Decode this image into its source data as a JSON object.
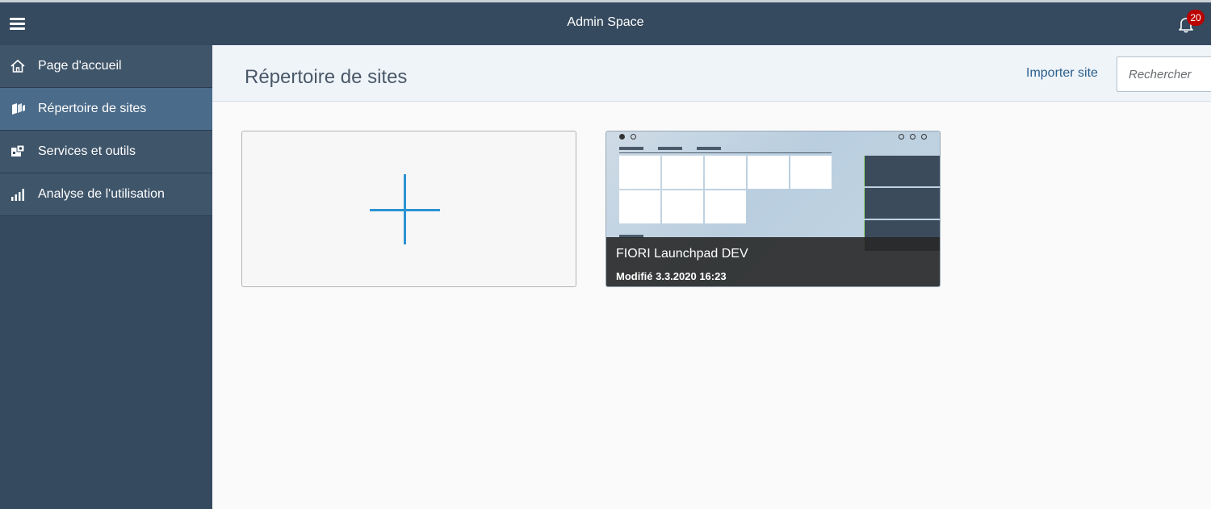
{
  "shell": {
    "title": "Admin Space",
    "notifications_count": "20"
  },
  "sidebar": {
    "items": [
      {
        "label": "Page d'accueil",
        "icon": "home-icon",
        "active": false
      },
      {
        "label": "Répertoire de sites",
        "icon": "sites-icon",
        "active": true
      },
      {
        "label": "Services et outils",
        "icon": "services-icon",
        "active": false
      },
      {
        "label": "Analyse de l'utilisation",
        "icon": "analytics-icon",
        "active": false
      }
    ]
  },
  "main": {
    "title": "Répertoire de sites",
    "import_label": "Importer site",
    "search_placeholder": "Rechercher"
  },
  "tiles": {
    "site": {
      "title": "FIORI Launchpad DEV",
      "modified": "Modifié 3.3.2020 16:23"
    }
  },
  "colors": {
    "shell": "#354a5f",
    "active_nav": "#4b6b8a",
    "accent": "#2c93d3",
    "badge": "#bb0000"
  }
}
